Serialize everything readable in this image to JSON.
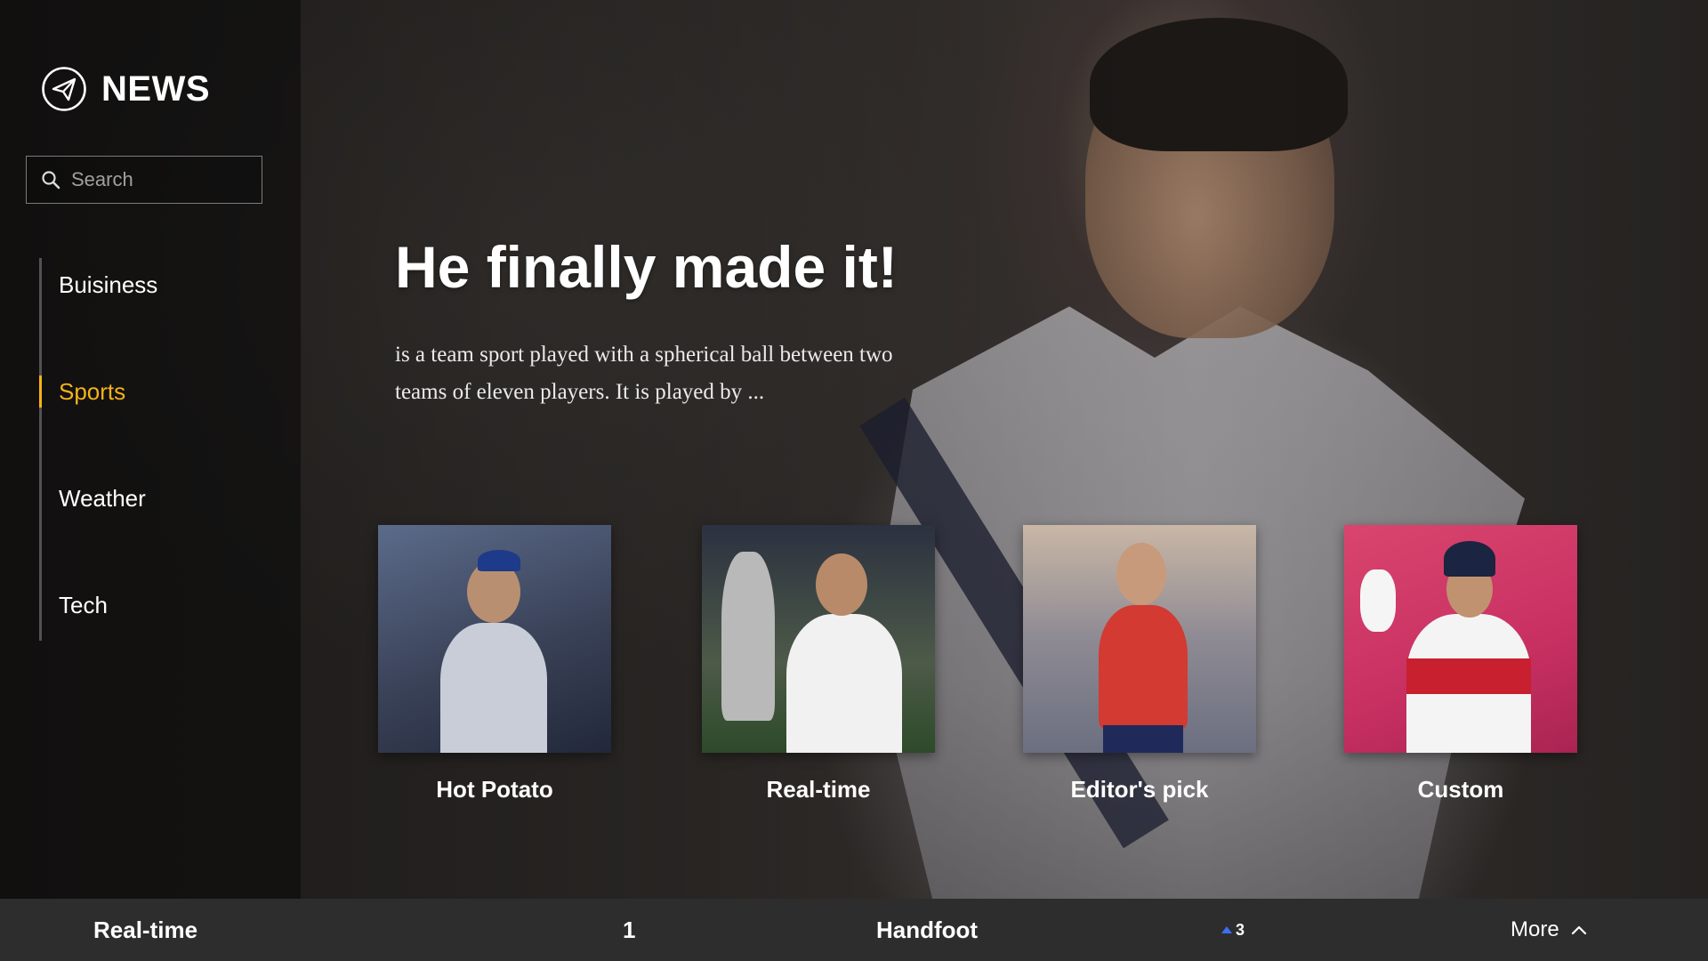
{
  "app": {
    "logo_text": "NEWS"
  },
  "search": {
    "placeholder": "Search",
    "value": ""
  },
  "nav": {
    "items": [
      {
        "label": "Buisiness",
        "active": false
      },
      {
        "label": "Sports",
        "active": true
      },
      {
        "label": "Weather",
        "active": false
      },
      {
        "label": "Tech",
        "active": false
      }
    ]
  },
  "hero": {
    "headline": "He finally made it!",
    "summary": "is a team sport played with a spherical ball between two teams of eleven players. It is played by ..."
  },
  "cards": [
    {
      "label": "Hot Potato"
    },
    {
      "label": "Real-time"
    },
    {
      "label": "Editor's pick"
    },
    {
      "label": "Custom"
    }
  ],
  "bottom_bar": {
    "title": "Real-time",
    "rank": "1",
    "topic": "Handfoot",
    "trend_value": "3",
    "trend_direction": "up",
    "more_label": "More"
  },
  "colors": {
    "accent": "#f5b21a",
    "trend_up": "#3a6ff5",
    "bottom_bar_bg": "#2d2d2d"
  },
  "icons": {
    "logo": "paper-plane-icon",
    "search": "search-icon",
    "more": "chevron-up-icon",
    "trend": "triangle-up-icon"
  }
}
